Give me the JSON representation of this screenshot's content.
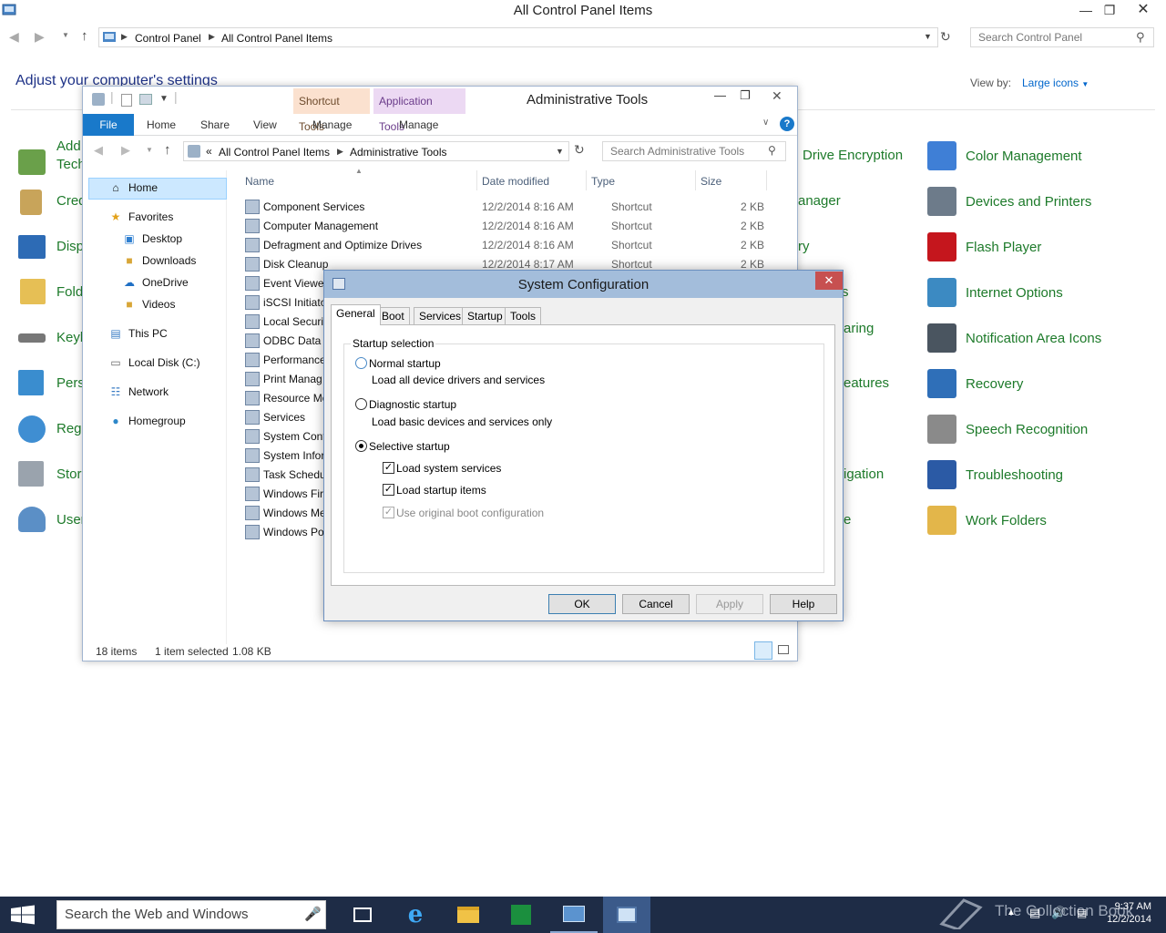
{
  "control_panel": {
    "title": "All Control Panel Items",
    "breadcrumb": [
      "Control Panel",
      "All Control Panel Items"
    ],
    "search_placeholder": "Search Control Panel",
    "heading": "Adjust your computer's settings",
    "view_by_label": "View by:",
    "view_by_value": "Large icons",
    "left_items": [
      "Add",
      "Tech",
      "Cred",
      "Disp",
      "Fold",
      "Keyb",
      "Pers",
      "Reg",
      "Stor",
      "User"
    ],
    "middle_items": [
      "Drive Encryption",
      "anager",
      "ry",
      "s",
      "aring",
      "eatures",
      "igation",
      "e"
    ],
    "right_items": [
      {
        "label": "Color Management",
        "icon": "color-management-icon",
        "color": "#3f7fd6"
      },
      {
        "label": "Devices and Printers",
        "icon": "printer-icon",
        "color": "#6d7b8a"
      },
      {
        "label": "Flash Player",
        "icon": "flash-icon",
        "color": "#c5161d"
      },
      {
        "label": "Internet Options",
        "icon": "globe-icon",
        "color": "#3c8ac2"
      },
      {
        "label": "Notification Area Icons",
        "icon": "notification-area-icon",
        "color": "#4a5560"
      },
      {
        "label": "Recovery",
        "icon": "recovery-icon",
        "color": "#2f6fb8"
      },
      {
        "label": "Speech Recognition",
        "icon": "microphone-icon",
        "color": "#8a8a8a"
      },
      {
        "label": "Troubleshooting",
        "icon": "troubleshooting-icon",
        "color": "#2b5aa5"
      },
      {
        "label": "Work Folders",
        "icon": "folder-icon",
        "color": "#e3b64a"
      }
    ]
  },
  "admin_tools": {
    "title": "Administrative Tools",
    "context_shortcut": "Shortcut Tools",
    "context_application": "Application Tools",
    "ribbon_tabs": [
      "File",
      "Home",
      "Share",
      "View",
      "Manage",
      "Manage"
    ],
    "address": [
      "All Control Panel Items",
      "Administrative Tools"
    ],
    "search_placeholder": "Search Administrative Tools",
    "columns": [
      "Name",
      "Date modified",
      "Type",
      "Size"
    ],
    "nav": [
      "Home",
      "Favorites",
      "Desktop",
      "Downloads",
      "OneDrive",
      "Videos",
      "This PC",
      "Local Disk (C:)",
      "Network",
      "Homegroup"
    ],
    "rows": [
      {
        "name": "Component Services",
        "date": "12/2/2014 8:16 AM",
        "type": "Shortcut",
        "size": "2 KB"
      },
      {
        "name": "Computer Management",
        "date": "12/2/2014 8:16 AM",
        "type": "Shortcut",
        "size": "2 KB"
      },
      {
        "name": "Defragment and Optimize Drives",
        "date": "12/2/2014 8:16 AM",
        "type": "Shortcut",
        "size": "2 KB"
      },
      {
        "name": "Disk Cleanup",
        "date": "12/2/2014 8:17 AM",
        "type": "Shortcut",
        "size": "2 KB"
      },
      {
        "name": "Event Viewer",
        "date": "",
        "type": "",
        "size": ""
      },
      {
        "name": "iSCSI Initiato",
        "date": "",
        "type": "",
        "size": ""
      },
      {
        "name": "Local Securit",
        "date": "",
        "type": "",
        "size": ""
      },
      {
        "name": "ODBC Data S",
        "date": "",
        "type": "",
        "size": ""
      },
      {
        "name": "Performance",
        "date": "",
        "type": "",
        "size": ""
      },
      {
        "name": "Print Manag",
        "date": "",
        "type": "",
        "size": ""
      },
      {
        "name": "Resource Mo",
        "date": "",
        "type": "",
        "size": ""
      },
      {
        "name": "Services",
        "date": "",
        "type": "",
        "size": ""
      },
      {
        "name": "System Conf",
        "date": "",
        "type": "",
        "size": ""
      },
      {
        "name": "System Infor",
        "date": "",
        "type": "",
        "size": ""
      },
      {
        "name": "Task Schedu",
        "date": "",
        "type": "",
        "size": ""
      },
      {
        "name": "Windows Fir",
        "date": "",
        "type": "",
        "size": ""
      },
      {
        "name": "Windows Me",
        "date": "",
        "type": "",
        "size": ""
      },
      {
        "name": "Windows Po",
        "date": "",
        "type": "",
        "size": ""
      }
    ],
    "status_count": "18 items",
    "status_selected": "1 item selected",
    "status_size": "1.08 KB"
  },
  "sysconfig": {
    "title": "System Configuration",
    "tabs": [
      "General",
      "Boot",
      "Services",
      "Startup",
      "Tools"
    ],
    "group_label": "Startup selection",
    "normal_label": "Normal startup",
    "normal_desc": "Load all device drivers and services",
    "diagnostic_label": "Diagnostic startup",
    "diagnostic_desc": "Load basic devices and services only",
    "selective_label": "Selective startup",
    "load_system_services": "Load system services",
    "load_startup_items": "Load startup items",
    "use_original_boot": "Use original boot configuration",
    "selected_option": "Selective startup",
    "buttons": {
      "ok": "OK",
      "cancel": "Cancel",
      "apply": "Apply",
      "help": "Help"
    }
  },
  "taskbar": {
    "search_placeholder": "Search the Web and Windows",
    "time": "9:37 AM",
    "date": "12/2/2014",
    "watermark": "The Collection Book"
  }
}
